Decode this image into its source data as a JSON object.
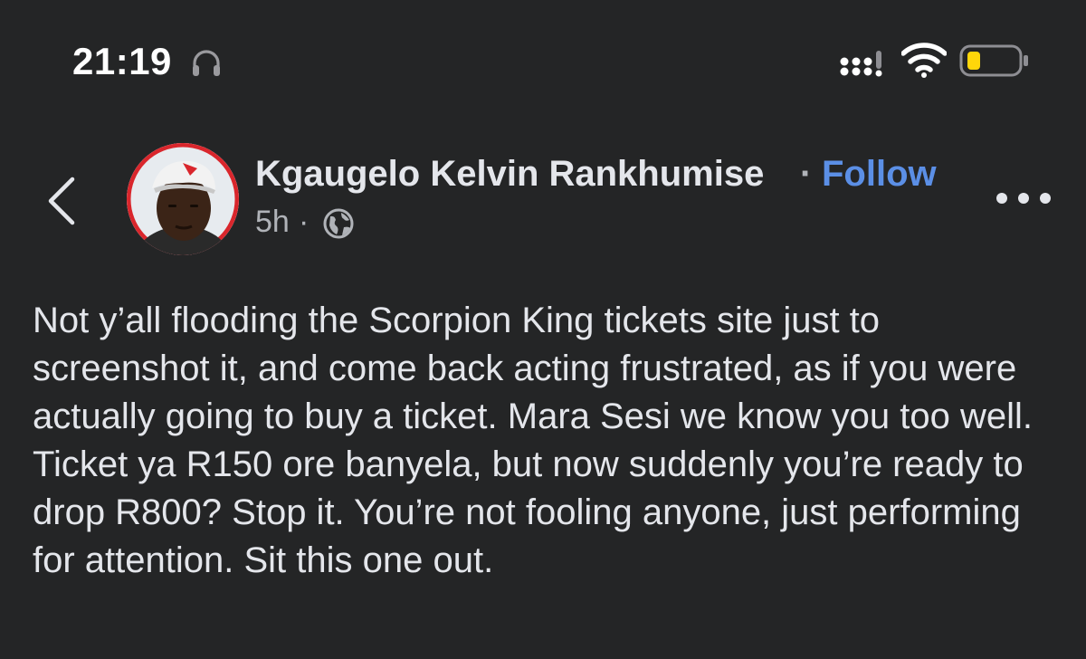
{
  "status_bar": {
    "time": "21:19",
    "icons": [
      "headphones-icon",
      "cellular-signal-icon",
      "wifi-icon",
      "battery-low-icon"
    ],
    "battery_color": "#ffd60a"
  },
  "post": {
    "author": "Kgaugelo Kelvin Rankhumise",
    "separator": "·",
    "follow_label": "Follow",
    "time_ago": "5h",
    "time_separator": "·",
    "audience_icon": "globe-icon",
    "body": "Not y’all flooding the Scorpion King tickets site just to screenshot it, and come back acting frustrated, as if you were actually going to buy a ticket. Mara Sesi we know you too well. Ticket ya R150 ore banyela, but now suddenly you’re ready to drop R800? Stop it. You’re not fooling anyone,  just performing for attention. Sit this one out."
  },
  "colors": {
    "background": "#242526",
    "text": "#e4e6eb",
    "secondary_text": "#b0b3b8",
    "link": "#5b8fe6"
  }
}
